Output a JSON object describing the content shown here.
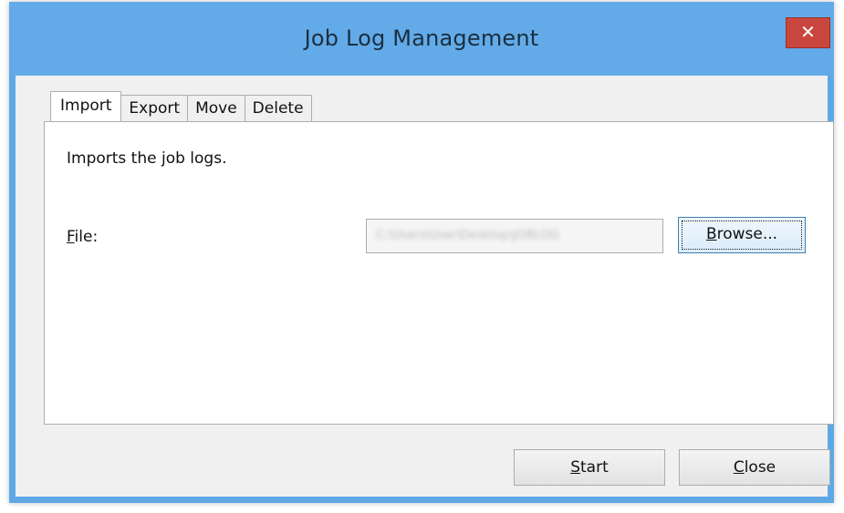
{
  "window": {
    "title": "Job Log Management",
    "close_glyph": "✕",
    "title_color": "#63abe8",
    "close_color": "#c8463d"
  },
  "tabs": [
    {
      "label": "Import",
      "active": true
    },
    {
      "label": "Export",
      "active": false
    },
    {
      "label": "Move",
      "active": false
    },
    {
      "label": "Delete",
      "active": false
    }
  ],
  "import_panel": {
    "description": "Imports the job logs.",
    "file_label_mnemonic": "F",
    "file_label_rest": "ile:",
    "file_value": "C:\\Users\\User\\Desktop\\JOBLOG",
    "browse_mnemonic": "B",
    "browse_rest": "rowse..."
  },
  "footer": {
    "start_mnemonic": "S",
    "start_rest": "tart",
    "close_mnemonic": "C",
    "close_rest": "lose"
  }
}
